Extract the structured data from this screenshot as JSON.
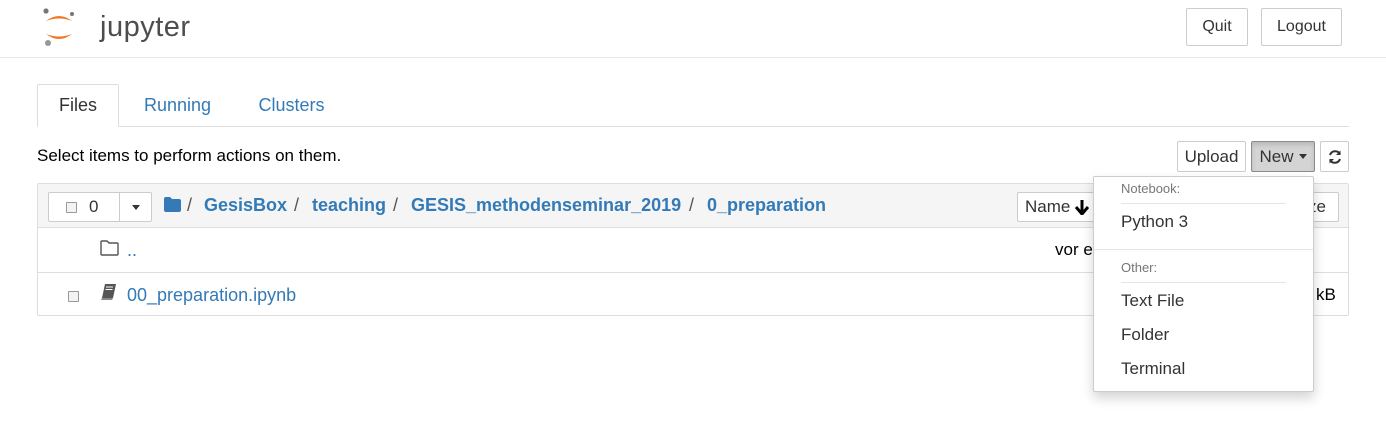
{
  "app": {
    "name": "jupyter"
  },
  "header": {
    "quit_label": "Quit",
    "logout_label": "Logout"
  },
  "tabs": [
    {
      "label": "Files",
      "active": true
    },
    {
      "label": "Running",
      "active": false
    },
    {
      "label": "Clusters",
      "active": false
    }
  ],
  "toolbar": {
    "hint": "Select items to perform actions on them.",
    "upload_label": "Upload",
    "new_label": "New",
    "refresh_icon": "refresh-icon"
  },
  "list_header": {
    "selected_count": "0",
    "breadcrumb": [
      "GesisBox",
      "teaching",
      "GESIS_methodenseminar_2019",
      "0_preparation"
    ],
    "sort_label": "Name",
    "size_label_partial": "ze"
  },
  "rows": [
    {
      "name": "..",
      "modified_partial": "vor e",
      "type": "folder"
    },
    {
      "name": "00_preparation.ipynb",
      "size_partial": "kB",
      "type": "notebook"
    }
  ],
  "new_menu": {
    "notebook_header": "Notebook:",
    "notebook_items": [
      "Python 3"
    ],
    "other_header": "Other:",
    "other_items": [
      "Text File",
      "Folder",
      "Terminal"
    ]
  },
  "colors": {
    "accent": "#337ab7",
    "logo_orange": "#f37726"
  }
}
